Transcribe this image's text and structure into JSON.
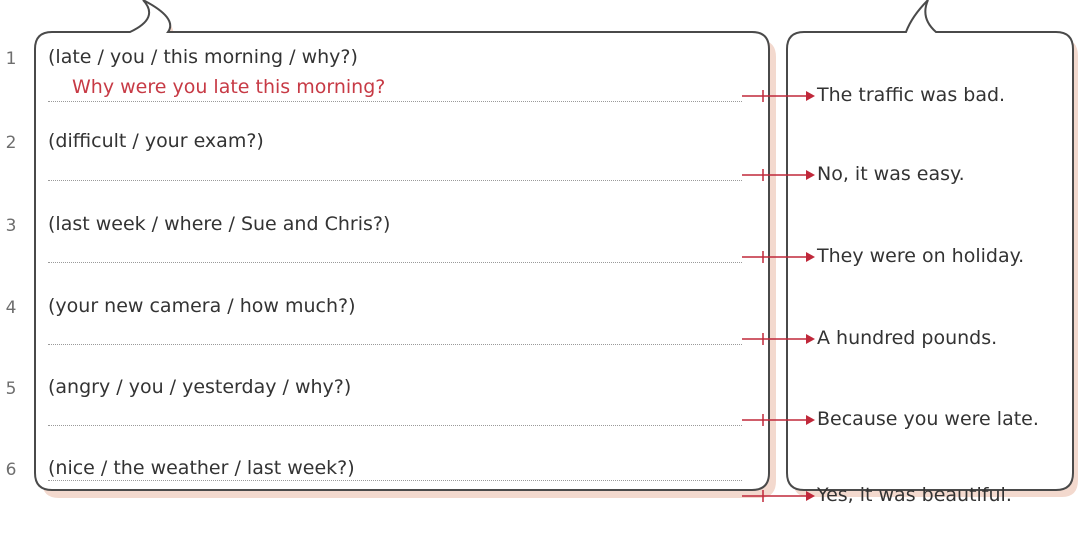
{
  "exercise": {
    "items": [
      {
        "number": "1",
        "prompt": "(late / you / this morning / why?)",
        "answer": "Why were you late this morning?",
        "reply": "The traffic was bad."
      },
      {
        "number": "2",
        "prompt": "(difficult / your exam?)",
        "answer": "",
        "reply": "No, it was easy."
      },
      {
        "number": "3",
        "prompt": "(last week / where / Sue and Chris?)",
        "answer": "",
        "reply": "They were on holiday."
      },
      {
        "number": "4",
        "prompt": "(your new camera / how much?)",
        "answer": "",
        "reply": "A hundred pounds."
      },
      {
        "number": "5",
        "prompt": "(angry / you / yesterday / why?)",
        "answer": "",
        "reply": "Because you were late."
      },
      {
        "number": "6",
        "prompt": "(nice / the weather / last week?)",
        "answer": "",
        "reply": "Yes, it was beautiful."
      }
    ]
  },
  "colors": {
    "bubble_border": "#4a4a4a",
    "bubble_shadow": "#e8c3b4",
    "arrow": "#c0283a",
    "answer_text": "#c73a45"
  }
}
